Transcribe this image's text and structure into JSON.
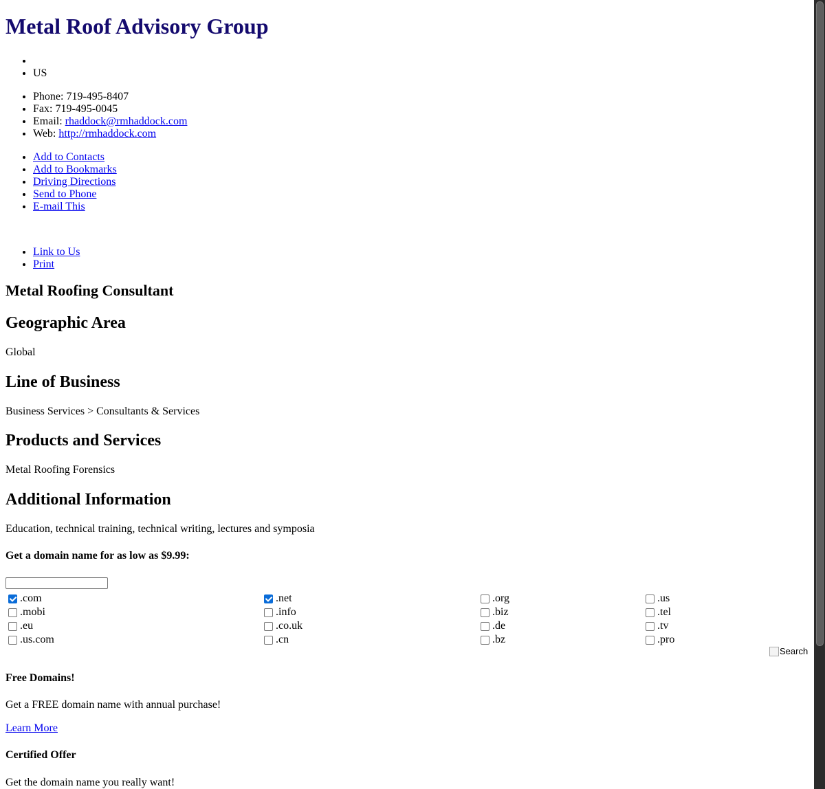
{
  "business": {
    "name": "Metal Roof Advisory Group",
    "address_lines": [
      "",
      "US"
    ],
    "contacts": [
      {
        "label": "Phone: ",
        "value": "719-495-8407"
      },
      {
        "label": "Fax: ",
        "value": "719-495-0045"
      },
      {
        "label": "Email: ",
        "link": "rhaddock@rmhaddock.com"
      },
      {
        "label": "Web: ",
        "link": "http://rmhaddock.com"
      }
    ],
    "actions": [
      "Add to Contacts",
      "Add to Bookmarks",
      "Driving Directions",
      "Send to Phone",
      "E-mail This"
    ],
    "secondary_actions": [
      "Link to Us",
      "Print"
    ],
    "tagline": "Metal Roofing Consultant"
  },
  "sections": [
    {
      "heading": "Geographic Area",
      "body": "Global"
    },
    {
      "heading": "Line of Business",
      "body": "Business Services > Consultants & Services"
    },
    {
      "heading": "Products and Services",
      "body": "Metal Roofing Forensics"
    },
    {
      "heading": "Additional Information",
      "body": "Education, technical training, technical writing, lectures and symposia"
    }
  ],
  "domain_search": {
    "heading": "Get a domain name for as low as $9.99:",
    "input_value": "",
    "tlds": [
      {
        "label": ".com",
        "checked": true
      },
      {
        "label": ".net",
        "checked": true
      },
      {
        "label": ".org",
        "checked": false
      },
      {
        "label": ".us",
        "checked": false
      },
      {
        "label": ".mobi",
        "checked": false
      },
      {
        "label": ".info",
        "checked": false
      },
      {
        "label": ".biz",
        "checked": false
      },
      {
        "label": ".tel",
        "checked": false
      },
      {
        "label": ".eu",
        "checked": false
      },
      {
        "label": ".co.uk",
        "checked": false
      },
      {
        "label": ".de",
        "checked": false
      },
      {
        "label": ".tv",
        "checked": false
      },
      {
        "label": ".us.com",
        "checked": false
      },
      {
        "label": ".cn",
        "checked": false
      },
      {
        "label": ".bz",
        "checked": false
      },
      {
        "label": ".pro",
        "checked": false
      }
    ],
    "search_alt": "Search"
  },
  "promos": [
    {
      "heading": "Free Domains!",
      "body": "Get a FREE domain name with annual purchase!",
      "link": "Learn More"
    },
    {
      "heading": "Certified Offer",
      "body": "Get the domain name you really want!"
    }
  ]
}
